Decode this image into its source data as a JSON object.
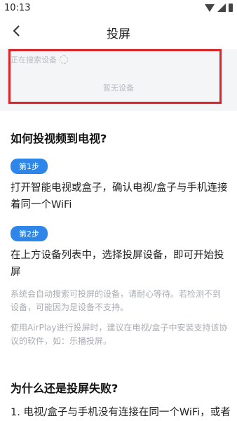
{
  "status_bar": {
    "time": "10:13"
  },
  "header": {
    "title": "投屏"
  },
  "device_list": {
    "searching_label": "正在搜索设备",
    "empty_label": "暂无设备"
  },
  "help": {
    "title": "如何投视频到电视?",
    "steps": [
      {
        "badge": "第1步",
        "text": "打开智能电视或盒子，确认电视/盒子与手机连接着同一个WiFi"
      },
      {
        "badge": "第2步",
        "text": "在上方设备列表中，选择投屏设备，即可开始投屏"
      }
    ],
    "notes": [
      "系统会自动搜索可投屏的设备，请耐心等待。若检测不到设备，可能因为是设备不支持。",
      "使用AirPlay进行投屏时，建议在电视/盒子中安装支持该协议的软件，如：乐播投屏。"
    ]
  },
  "faq": {
    "title": "为什么还是投屏失败?",
    "items": [
      "1. 电视/盒子与手机没有连接在同一个WiFi，或者"
    ]
  },
  "colors": {
    "accent": "#2d86e8",
    "highlight": "#d9262b",
    "panel_bg": "#f4f5f7"
  }
}
